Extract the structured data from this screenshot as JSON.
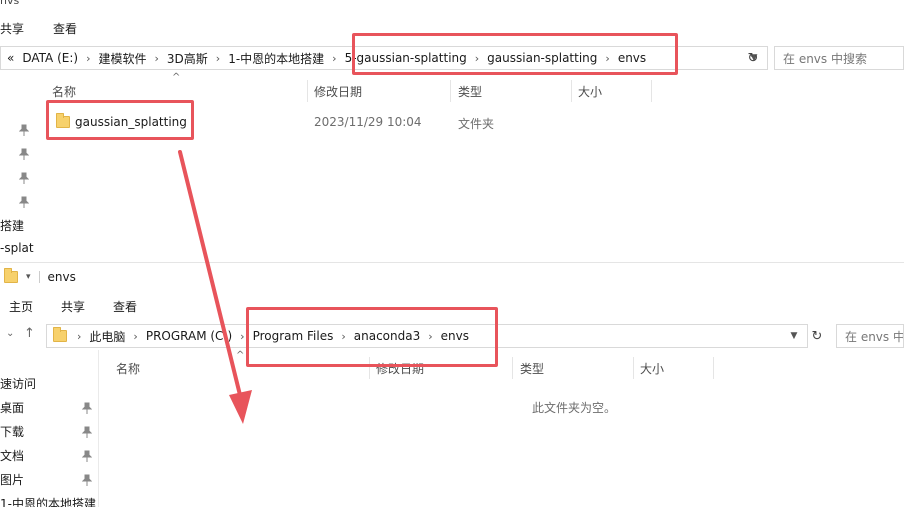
{
  "top_window": {
    "title_fragment": "nvs",
    "ribbon": [
      "共享",
      "查看"
    ],
    "breadcrumb": [
      "DATA (E:)",
      "建模软件",
      "3D高斯",
      "1-中恩的本地搭建",
      "5-gaussian-splatting",
      "gaussian-splatting",
      "envs"
    ],
    "overflow_label": "«",
    "search_placeholder": "在 envs 中搜索",
    "columns": [
      "名称",
      "修改日期",
      "类型",
      "大小"
    ],
    "rows": [
      {
        "name": "gaussian_splatting",
        "modified": "2023/11/29 10:04",
        "type": "文件夹",
        "size": ""
      }
    ],
    "sidebar": [
      "搭建",
      "-splat"
    ]
  },
  "bottom_window": {
    "title": "envs",
    "ribbon": [
      "主页",
      "共享",
      "查看"
    ],
    "breadcrumb": [
      "此电脑",
      "PROGRAM (C:)",
      "Program Files",
      "anaconda3",
      "envs"
    ],
    "search_placeholder": "在 envs 中",
    "columns": [
      "名称",
      "修改日期",
      "类型",
      "大小"
    ],
    "empty_message": "此文件夹为空。",
    "sidebar": [
      "速访问",
      "桌面",
      "下载",
      "文档",
      "图片",
      "1-中恩的本地搭建"
    ]
  },
  "colors": {
    "highlight": "#e8545b",
    "folder": "#f7d16c"
  },
  "icons": {
    "back": "arrow-up-icon",
    "refresh": "refresh-icon",
    "pin": "pin-icon",
    "folder": "folder-icon"
  }
}
